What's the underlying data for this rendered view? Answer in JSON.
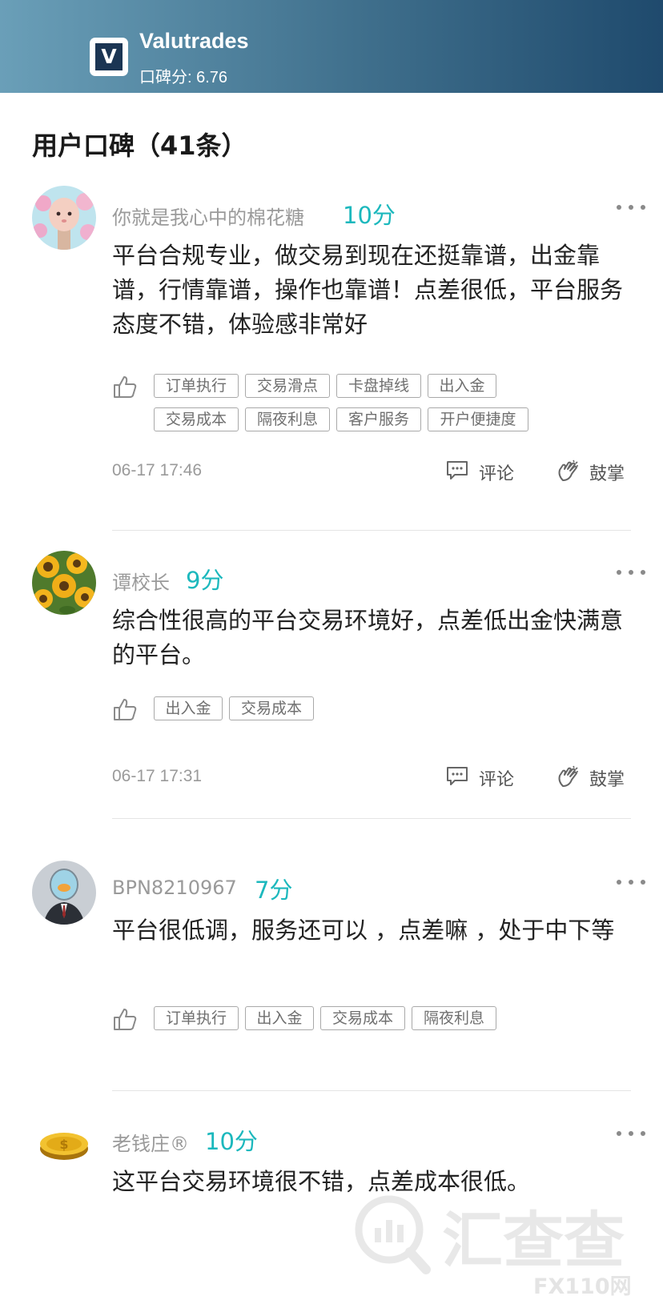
{
  "header": {
    "logo_letter": "V",
    "title": "Valutrades",
    "score_label": "口碑分: ",
    "score_value": "6.76"
  },
  "section": {
    "title": "用户口碑（41条）"
  },
  "reviews": [
    {
      "username": "你就是我心中的棉花糖",
      "rating": "10分",
      "content": "平台合规专业，做交易到现在还挺靠谱，出金靠谱，行情靠谱，操作也靠谱！点差很低，平台服务态度不错，体验感非常好",
      "tags": [
        "订单执行",
        "交易滑点",
        "卡盘掉线",
        "出入金",
        "交易成本",
        "隔夜利息",
        "客户服务",
        "开户便捷度"
      ],
      "time": "06-17 17:46",
      "comment_label": "评论",
      "clap_label": "鼓掌"
    },
    {
      "username": "谭校长",
      "rating": "9分",
      "content": "综合性很高的平台交易环境好，点差低出金快满意的平台。",
      "tags": [
        "出入金",
        "交易成本"
      ],
      "time": "06-17 17:31",
      "comment_label": "评论",
      "clap_label": "鼓掌"
    },
    {
      "username": "BPN8210967",
      "rating": "7分",
      "content": "平台很低调，服务还可以 ，点差嘛 ，处于中下等",
      "tags": [
        "订单执行",
        "出入金",
        "交易成本",
        "隔夜利息"
      ]
    },
    {
      "username": "老钱庄®",
      "rating": "10分",
      "content": "这平台交易环境很不错，点差成本很低。"
    }
  ],
  "watermark": {
    "text": "汇查查",
    "sub": "FX110网"
  },
  "colors": {
    "accent": "#1cb8bd",
    "header_start": "#6a9fb8",
    "header_end": "#1f4a6d"
  }
}
